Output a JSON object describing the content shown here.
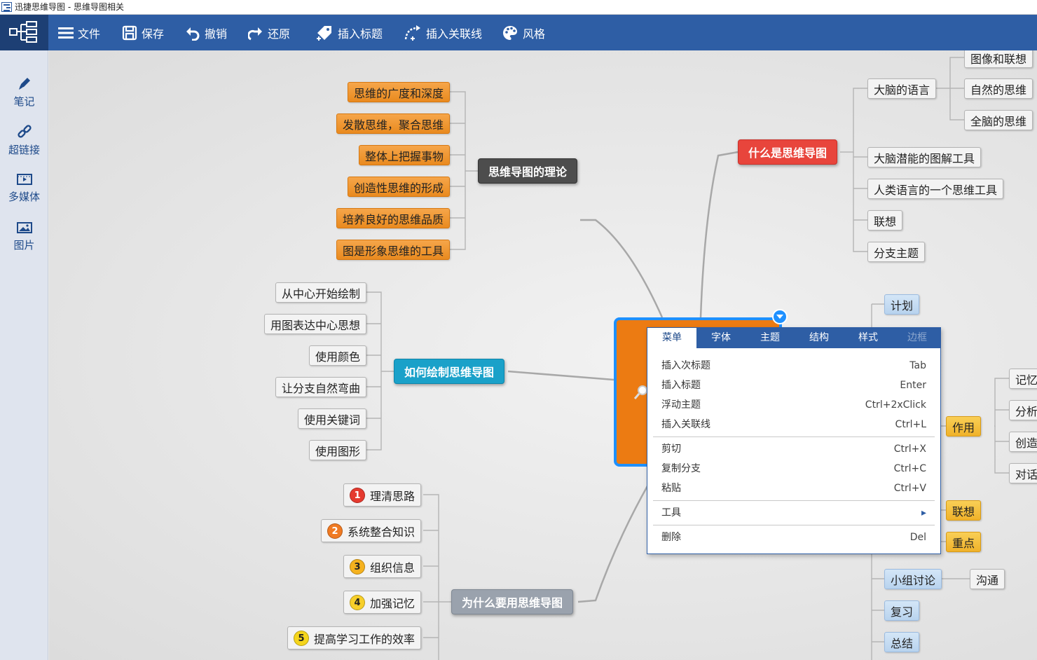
{
  "window": {
    "title": "迅捷思维导图 - 思维导图相关"
  },
  "toolbar": {
    "items": [
      {
        "label": "文件",
        "icon": "menu-icon"
      },
      {
        "label": "保存",
        "icon": "save-icon"
      },
      {
        "label": "撤销",
        "icon": "undo-icon"
      },
      {
        "label": "还原",
        "icon": "redo-icon"
      },
      {
        "label": "插入标题",
        "icon": "tag-icon"
      },
      {
        "label": "插入关联线",
        "icon": "connector-icon"
      },
      {
        "label": "风格",
        "icon": "palette-icon"
      }
    ]
  },
  "sidebar": {
    "items": [
      {
        "label": "笔记",
        "icon": "pencil-icon"
      },
      {
        "label": "超链接",
        "icon": "link-icon"
      },
      {
        "label": "多媒体",
        "icon": "media-icon"
      },
      {
        "label": "图片",
        "icon": "image-icon"
      }
    ]
  },
  "mindmap": {
    "theory": {
      "title": "思维导图的理论",
      "children": [
        "思维的广度和深度",
        "发散思维，聚合思维",
        "整体上把握事物",
        "创造性思维的形成",
        "培养良好的思维品质",
        "图是形象思维的工具"
      ]
    },
    "howto": {
      "title": "如何绘制思维导图",
      "children": [
        "从中心开始绘制",
        "用图表达中心思想",
        "使用颜色",
        "让分支自然弯曲",
        "使用关键词",
        "使用图形"
      ]
    },
    "why": {
      "title": "为什么要用思维导图",
      "children": [
        "理清思路",
        "系统整合知识",
        "组织信息",
        "加强记忆",
        "提高学习工作的效率"
      ],
      "numbers": [
        "1",
        "2",
        "3",
        "4",
        "5"
      ],
      "number_colors": [
        "#e53a2f",
        "#f07a22",
        "#f5b21f",
        "#f7cf2a",
        "#f5d51c"
      ]
    },
    "what": {
      "title": "什么是思维导图",
      "brain_language": "大脑的语言",
      "brain_language_children": [
        "图像和联想",
        "自然的思维",
        "全脑的思维"
      ],
      "children": [
        "大脑潜能的图解工具",
        "人类语言的一个思维工具",
        "联想",
        "分支主题"
      ]
    },
    "right_lower": {
      "plan": "计划",
      "effect": "作用",
      "effect_children": [
        "记忆",
        "分析",
        "创造",
        "对话"
      ],
      "association": "联想",
      "key_point": "重点",
      "group_discussion": "小组讨论",
      "communication": "沟通",
      "review": "复习",
      "summary": "总结"
    }
  },
  "context_menu": {
    "tabs": [
      "菜单",
      "字体",
      "主题",
      "结构",
      "样式",
      "边框"
    ],
    "items": [
      {
        "label": "插入次标题",
        "shortcut": "Tab"
      },
      {
        "label": "插入标题",
        "shortcut": "Enter"
      },
      {
        "label": "浮动主题",
        "shortcut": "Ctrl+2xClick"
      },
      {
        "label": "插入关联线",
        "shortcut": "Ctrl+L"
      },
      {
        "label": "剪切",
        "shortcut": "Ctrl+X"
      },
      {
        "label": "复制分支",
        "shortcut": "Ctrl+C"
      },
      {
        "label": "粘贴",
        "shortcut": "Ctrl+V"
      },
      {
        "label": "工具",
        "shortcut": ""
      },
      {
        "label": "删除",
        "shortcut": "Del"
      }
    ],
    "submenu_arrow": "▸"
  },
  "colors": {
    "toolbar_bg": "#2e5ea5",
    "center_node": "#ec7b12",
    "selection": "#1e90ff",
    "theory": "#4d4d4d",
    "what": "#e8453c",
    "howto": "#1aa1c9",
    "why": "#9aa2ad"
  }
}
